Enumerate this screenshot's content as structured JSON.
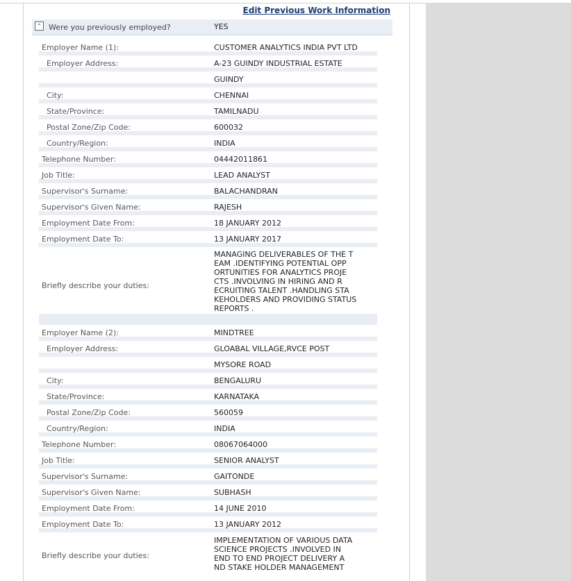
{
  "edit_link": "Edit Previous Work Information",
  "question": {
    "label": "Were you previously employed?",
    "value": "YES"
  },
  "employers": [
    {
      "rows": [
        {
          "label": "Employer Name (1):",
          "value": "CUSTOMER ANALYTICS INDIA PVT LTD",
          "indent": false
        },
        {
          "label": "Employer Address:",
          "value": "A-23 GUINDY INDUSTRIAL ESTATE",
          "indent": true
        },
        {
          "label": "",
          "value": "GUINDY",
          "indent": true
        },
        {
          "label": "City:",
          "value": "CHENNAI",
          "indent": true
        },
        {
          "label": "State/Province:",
          "value": "TAMILNADU",
          "indent": true
        },
        {
          "label": "Postal Zone/Zip Code:",
          "value": "600032",
          "indent": true
        },
        {
          "label": "Country/Region:",
          "value": "INDIA",
          "indent": true
        },
        {
          "label": "Telephone Number:",
          "value": "04442011861",
          "indent": false
        },
        {
          "label": "Job Title:",
          "value": "LEAD ANALYST",
          "indent": false
        },
        {
          "label": "Supervisor's Surname:",
          "value": "BALACHANDRAN",
          "indent": false
        },
        {
          "label": "Supervisor's Given Name:",
          "value": "RAJESH",
          "indent": false
        },
        {
          "label": "Employment Date From:",
          "value": "18 JANUARY 2012",
          "indent": false
        },
        {
          "label": "Employment Date To:",
          "value": "13 JANUARY 2017",
          "indent": false
        }
      ],
      "duties": {
        "label": "Briefly describe your duties:",
        "value": "MANAGING DELIVERABLES OF THE T\nEAM .IDENTIFYING POTENTIAL OPP\nORTUNITIES FOR ANALYTICS PROJE\nCTS .INVOLVING IN HIRING AND R\nECRUITING TALENT .HANDLING STA\nKEHOLDERS AND PROVIDING STATUS\nREPORTS ."
      }
    },
    {
      "rows": [
        {
          "label": "Employer Name (2):",
          "value": "MINDTREE",
          "indent": false
        },
        {
          "label": "Employer Address:",
          "value": "GLOABAL VILLAGE,RVCE POST",
          "indent": true
        },
        {
          "label": "",
          "value": "MYSORE ROAD",
          "indent": true
        },
        {
          "label": "City:",
          "value": "BENGALURU",
          "indent": true
        },
        {
          "label": "State/Province:",
          "value": "KARNATAKA",
          "indent": true
        },
        {
          "label": "Postal Zone/Zip Code:",
          "value": "560059",
          "indent": true
        },
        {
          "label": "Country/Region:",
          "value": "INDIA",
          "indent": true
        },
        {
          "label": "Telephone Number:",
          "value": "08067064000",
          "indent": false
        },
        {
          "label": "Job Title:",
          "value": "SENIOR ANALYST",
          "indent": false
        },
        {
          "label": "Supervisor's Surname:",
          "value": "GAITONDE",
          "indent": false
        },
        {
          "label": "Supervisor's Given Name:",
          "value": "SUBHASH",
          "indent": false
        },
        {
          "label": "Employment Date From:",
          "value": "14 JUNE 2010",
          "indent": false
        },
        {
          "label": "Employment Date To:",
          "value": "13 JANUARY 2012",
          "indent": false
        }
      ],
      "duties": {
        "label": "Briefly describe your duties:",
        "value": "IMPLEMENTATION OF VARIOUS DATA\nSCIENCE PROJECTS .INVOLVED IN\nEND TO END PROJECT DELIVERY A\nND STAKE HOLDER MANAGEMENT"
      }
    }
  ]
}
